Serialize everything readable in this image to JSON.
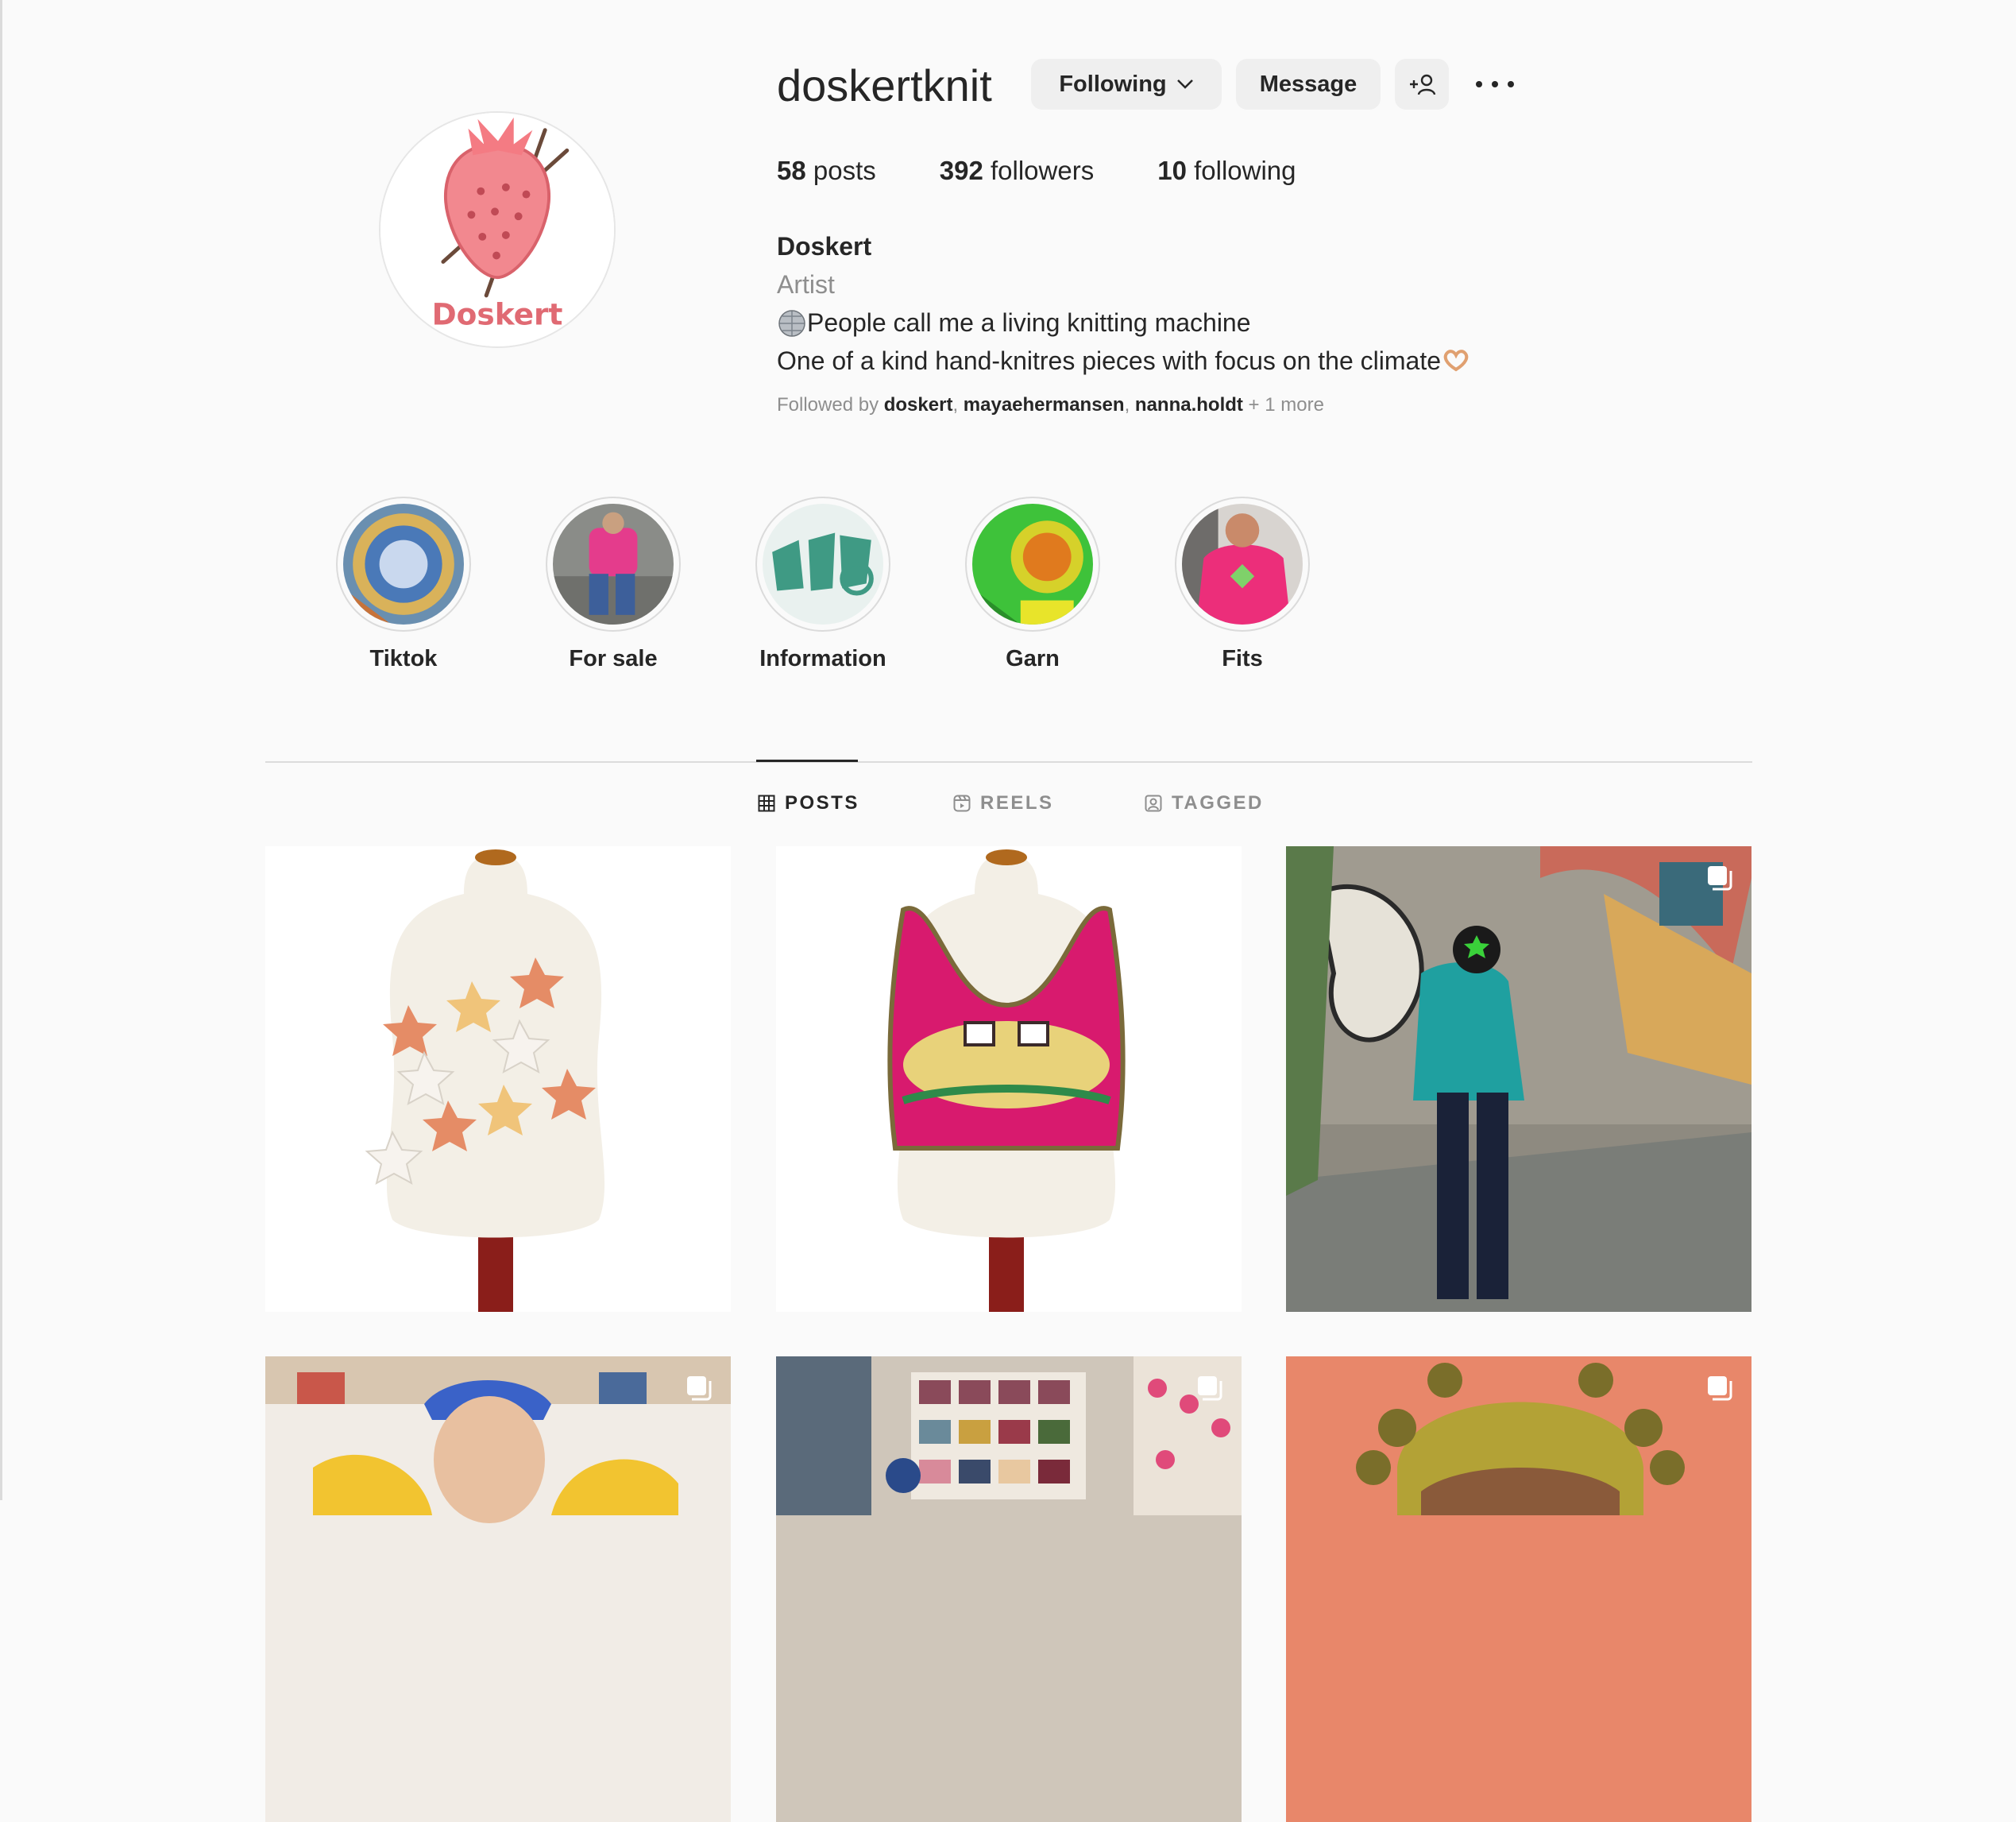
{
  "profile": {
    "username": "doskertknit",
    "avatar_text": "Doskert",
    "buttons": {
      "following_label": "Following",
      "message_label": "Message"
    },
    "stats": {
      "posts_count": "58",
      "posts_label": " posts",
      "followers_count": "392",
      "followers_label": " followers",
      "following_count": "10",
      "following_label": " following"
    },
    "bio": {
      "name": "Doskert",
      "category": "Artist",
      "line1": "People call me a living knitting machine",
      "line2": "One of a kind hand-knitres pieces with focus on the climate"
    },
    "followed_by": {
      "prefix": "Followed by ",
      "user1": "doskert",
      "user2": "mayaehermansen",
      "user3": "nanna.holdt",
      "more": " + 1 more"
    }
  },
  "highlights": [
    {
      "label": "Tiktok"
    },
    {
      "label": "For sale"
    },
    {
      "label": "Information"
    },
    {
      "label": "Garn"
    },
    {
      "label": "Fits"
    }
  ],
  "tabs": [
    {
      "label": "POSTS",
      "icon": "grid-icon",
      "active": true
    },
    {
      "label": "REELS",
      "icon": "reels-icon",
      "active": false
    },
    {
      "label": "TAGGED",
      "icon": "tagged-icon",
      "active": false
    }
  ],
  "colors": {
    "background": "#fafafa",
    "text": "#262626",
    "muted": "#8e8e8e",
    "button": "#efefef",
    "brand_pink": "#e87a80"
  }
}
